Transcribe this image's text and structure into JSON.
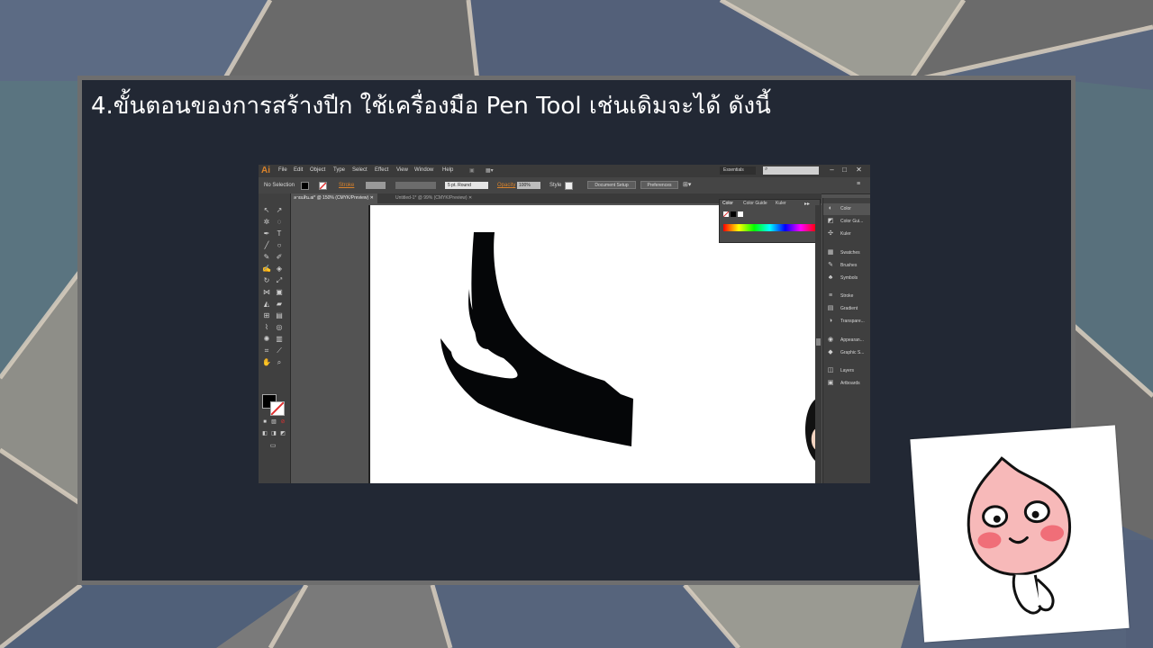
{
  "slide": {
    "title": "4.ขั้นตอนของการสร้างปีก ใช้เครื่องมือ Pen Tool เช่นเดิมจะได้  ดังนี้"
  },
  "app": {
    "logo": "Ai",
    "menu": [
      "File",
      "Edit",
      "Object",
      "Type",
      "Select",
      "Effect",
      "View",
      "Window",
      "Help"
    ],
    "workspace": "Essentials",
    "window_buttons": [
      "–",
      "□",
      "✕"
    ]
  },
  "control_bar": {
    "selection": "No Selection",
    "stroke_label": "Stroke",
    "brush": "5 pt. Round",
    "opacity_label": "Opacity",
    "opacity_value": "100%",
    "style_label": "Style",
    "doc_setup": "Document Setup",
    "preferences": "Preferences"
  },
  "tabs": [
    {
      "label": "ลายเส้น.ai* @ 150% (CMYK/Preview)",
      "active": true
    },
    {
      "label": "Untitled-1* @ 99% (CMYK/Preview)",
      "active": false
    }
  ],
  "color_panel": {
    "tabs": [
      "Color",
      "Color Guide",
      "Kuler"
    ]
  },
  "right_panel": {
    "items": [
      {
        "label": "Color",
        "icon": "palette-icon"
      },
      {
        "label": "Color Gui...",
        "icon": "color-guide-icon"
      },
      {
        "label": "Kuler",
        "icon": "kuler-icon"
      },
      {
        "label": "Swatches",
        "icon": "swatches-icon"
      },
      {
        "label": "Brushes",
        "icon": "brushes-icon"
      },
      {
        "label": "Symbols",
        "icon": "symbols-icon"
      },
      {
        "label": "Stroke",
        "icon": "stroke-icon"
      },
      {
        "label": "Gradient",
        "icon": "gradient-icon"
      },
      {
        "label": "Transpare...",
        "icon": "transparency-icon"
      },
      {
        "label": "Appearan...",
        "icon": "appearance-icon"
      },
      {
        "label": "Graphic S...",
        "icon": "graphic-styles-icon"
      },
      {
        "label": "Layers",
        "icon": "layers-icon"
      },
      {
        "label": "Artboards",
        "icon": "artboards-icon"
      }
    ]
  },
  "colors": {
    "slide_bg": "#222834",
    "accent_orange": "#d9822b",
    "wing": "#050608"
  }
}
